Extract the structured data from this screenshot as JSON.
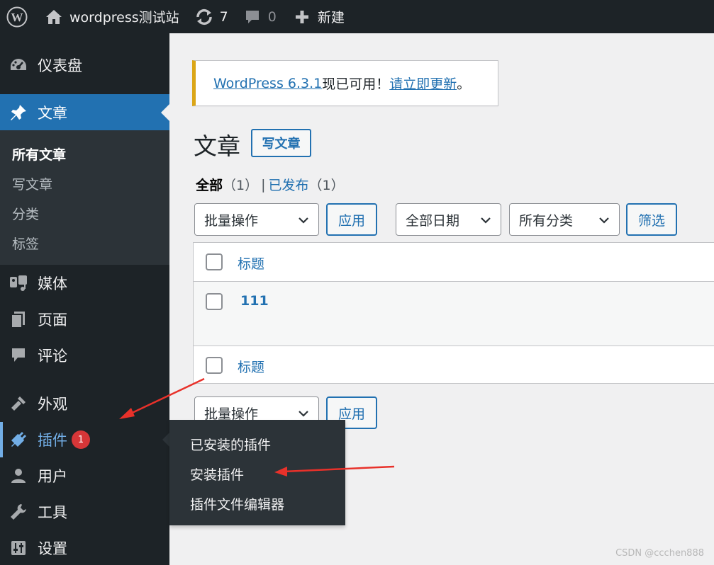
{
  "admin_bar": {
    "wp_logo_icon": "wordpress-logo-icon",
    "site_name": "wordpress测试站",
    "updates_count": "7",
    "comments_count": "0",
    "new_label": "新建"
  },
  "sidebar": {
    "items": [
      {
        "label": "仪表盘",
        "icon": "dashboard-icon"
      },
      {
        "label": "文章",
        "icon": "pushpin-icon"
      },
      {
        "label": "媒体",
        "icon": "media-icon"
      },
      {
        "label": "页面",
        "icon": "page-icon"
      },
      {
        "label": "评论",
        "icon": "comment-icon"
      },
      {
        "label": "外观",
        "icon": "paintbrush-icon"
      },
      {
        "label": "插件",
        "icon": "plugin-icon",
        "badge": "1"
      },
      {
        "label": "用户",
        "icon": "user-icon"
      },
      {
        "label": "工具",
        "icon": "wrench-icon"
      },
      {
        "label": "设置",
        "icon": "settings-icon"
      }
    ],
    "posts_submenu": [
      "所有文章",
      "写文章",
      "分类",
      "标签"
    ]
  },
  "plugins_flyout": [
    "已安装的插件",
    "安装插件",
    "插件文件编辑器"
  ],
  "notice": {
    "version_link": "WordPress 6.3.1",
    "text_mid": "现已可用！",
    "update_link": "请立即更新",
    "text_end": "。"
  },
  "page": {
    "title": "文章",
    "add_new": "写文章"
  },
  "filters": {
    "all_label": "全部",
    "all_count": "（1）",
    "separator": "|",
    "published_label": "已发布",
    "published_count": "（1）",
    "bulk_action": "批量操作",
    "apply": "应用",
    "all_dates": "全部日期",
    "all_categories": "所有分类",
    "filter": "筛选"
  },
  "table": {
    "header_title": "标题",
    "footer_title": "标题",
    "rows": [
      {
        "title": "111"
      }
    ]
  },
  "bottom_bar": {
    "bulk_action": "批量操作",
    "apply": "应用"
  },
  "watermark": "CSDN @ccchen888",
  "colors": {
    "admin_bg": "#1d2327",
    "accent": "#2271b1",
    "notice_border": "#dba617",
    "badge": "#d63638",
    "arrow": "#e8312a"
  }
}
